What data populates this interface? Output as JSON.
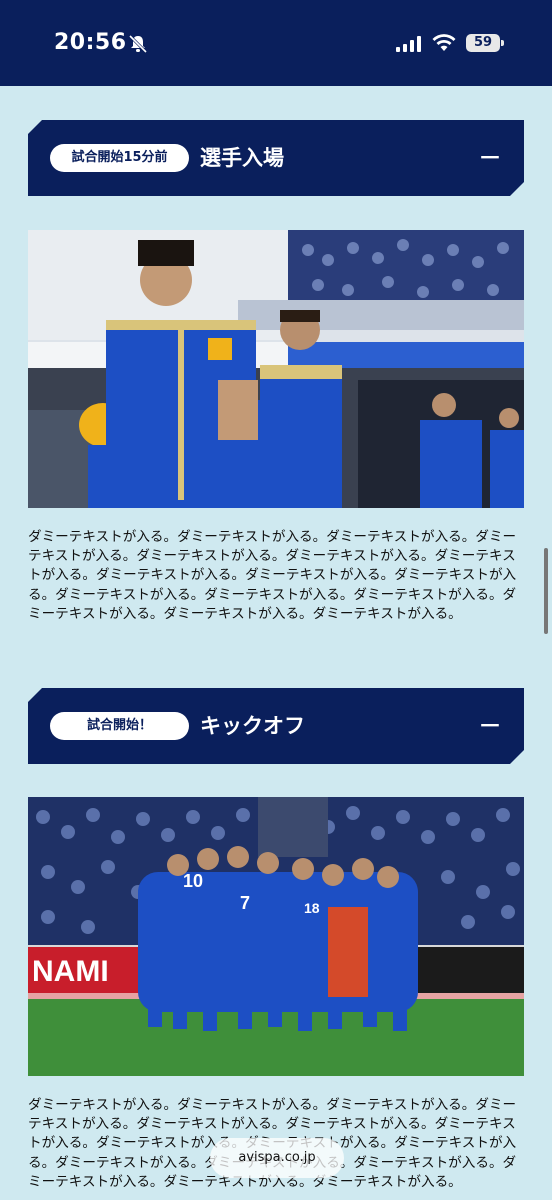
{
  "status_bar": {
    "time": "20:56",
    "battery": "59",
    "icons": [
      "bell-slash-icon",
      "signal-icon",
      "wifi-icon",
      "battery-icon"
    ]
  },
  "sections": [
    {
      "badge": "試合開始15分前",
      "title": "選手入場",
      "collapse_icon": "minus-icon",
      "photo_alt": "",
      "body": "ダミーテキストが入る。ダミーテキストが入る。ダミーテキストが入る。ダミーテキストが入る。ダミーテキストが入る。ダミーテキストが入る。ダミーテキストが入る。ダミーテキストが入る。ダミーテキストが入る。ダミーテキストが入る。ダミーテキストが入る。ダミーテキストが入る。ダミーテキストが入る。ダミーテキストが入る。ダミーテキストが入る。ダミーテキストが入る。"
    },
    {
      "badge": "試合開始！",
      "title": "キックオフ",
      "collapse_icon": "minus-icon",
      "photo_alt": "",
      "body": "ダミーテキストが入る。ダミーテキストが入る。ダミーテキストが入る。ダミーテキストが入る。ダミーテキストが入る。ダミーテキストが入る。ダミーテキストが入る。ダミーテキストが入る。ダミーテキストが入る。ダミーテキストが入る。ダミーテキストが入る。ダミーテキストが入る。ダミーテキストが入る。ダミーテキストが入る。ダミーテキストが入る。ダミーテキストが入る。"
    }
  ],
  "photo2_signage": "NAMI",
  "url_bar": "avispa.co.jp",
  "colors": {
    "navy": "#0a1f5c",
    "background": "#cfe9f0",
    "kit_blue": "#1d4fc4"
  }
}
